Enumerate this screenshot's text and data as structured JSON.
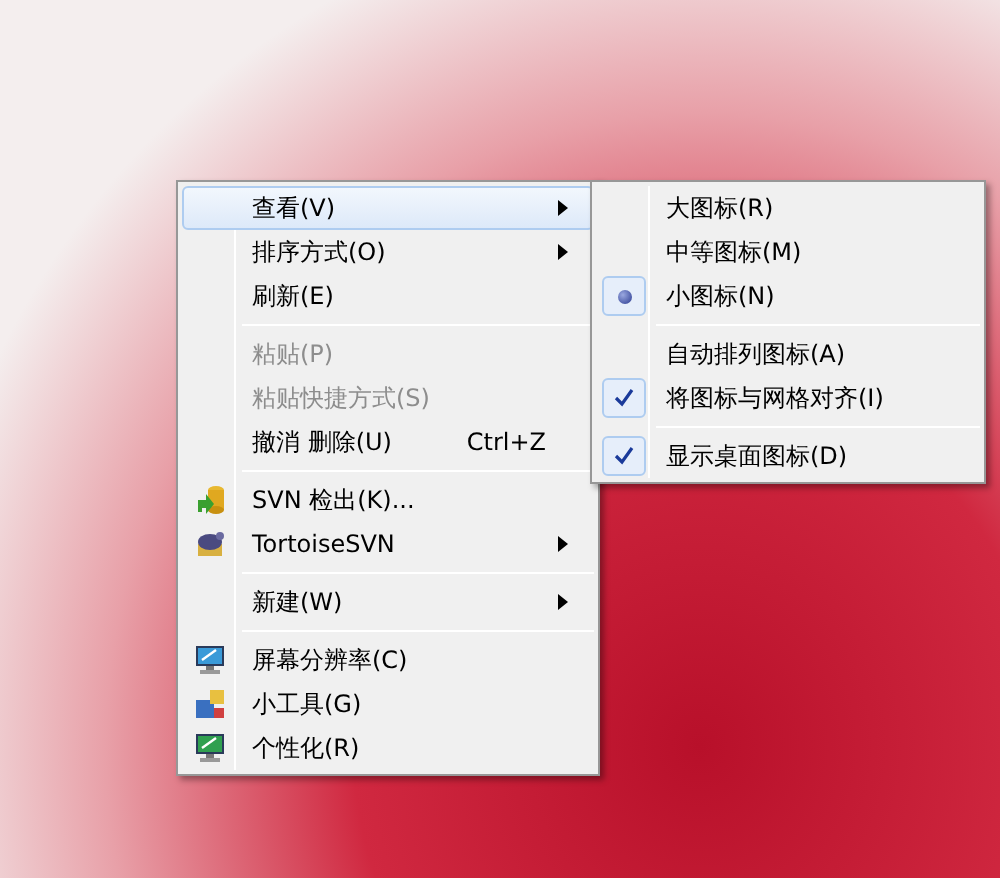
{
  "context_menu": {
    "groups": [
      {
        "items": [
          {
            "label": "查看(V)",
            "submenu": true,
            "selected": true,
            "disabled": false
          },
          {
            "label": "排序方式(O)",
            "submenu": true,
            "selected": false,
            "disabled": false
          },
          {
            "label": "刷新(E)",
            "submenu": false,
            "selected": false,
            "disabled": false
          }
        ]
      },
      {
        "items": [
          {
            "label": "粘贴(P)",
            "submenu": false,
            "selected": false,
            "disabled": true
          },
          {
            "label": "粘贴快捷方式(S)",
            "submenu": false,
            "selected": false,
            "disabled": true
          },
          {
            "label": "撤消 删除(U)",
            "shortcut": "Ctrl+Z",
            "submenu": false,
            "selected": false,
            "disabled": false
          }
        ]
      },
      {
        "items": [
          {
            "label": "SVN 检出(K)...",
            "submenu": false,
            "selected": false,
            "disabled": false
          },
          {
            "label": "TortoiseSVN",
            "submenu": true,
            "selected": false,
            "disabled": false
          }
        ]
      },
      {
        "items": [
          {
            "label": "新建(W)",
            "submenu": true,
            "selected": false,
            "disabled": false
          }
        ]
      },
      {
        "items": [
          {
            "label": "屏幕分辨率(C)",
            "submenu": false,
            "selected": false,
            "disabled": false
          },
          {
            "label": "小工具(G)",
            "submenu": false,
            "selected": false,
            "disabled": false
          },
          {
            "label": "个性化(R)",
            "submenu": false,
            "selected": false,
            "disabled": false
          }
        ]
      }
    ]
  },
  "view_submenu": {
    "groups": [
      {
        "items": [
          {
            "label": "大图标(R)",
            "kind": "radio",
            "checked": false
          },
          {
            "label": "中等图标(M)",
            "kind": "radio",
            "checked": false
          },
          {
            "label": "小图标(N)",
            "kind": "radio",
            "checked": true
          }
        ]
      },
      {
        "items": [
          {
            "label": "自动排列图标(A)",
            "kind": "check",
            "checked": false
          },
          {
            "label": "将图标与网格对齐(I)",
            "kind": "check",
            "checked": true
          }
        ]
      },
      {
        "items": [
          {
            "label": "显示桌面图标(D)",
            "kind": "check",
            "checked": true
          }
        ]
      }
    ]
  }
}
